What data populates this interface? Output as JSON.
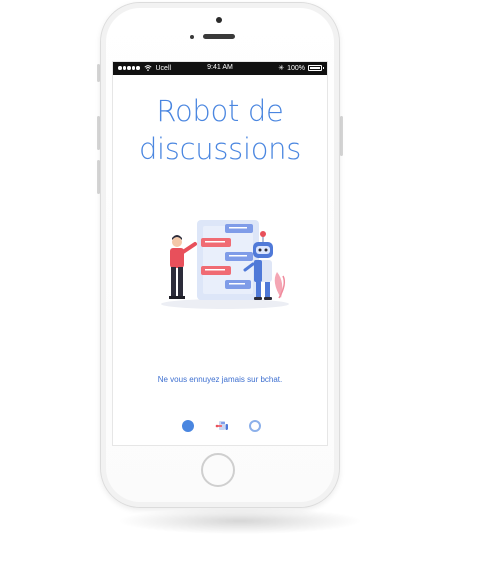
{
  "statusbar": {
    "carrier": "Ucell",
    "time": "9:41 AM",
    "battery_text": "100%",
    "battery_level": 1.0,
    "signal_icon": "signal-dots-icon",
    "wifi_icon": "wifi-icon",
    "bluetooth_icon": "bluetooth-icon"
  },
  "screen": {
    "title_line1": "Robot de",
    "title_line2": "discussions",
    "tagline": "Ne vous ennuyez jamais sur bchat.",
    "illustration": "man-chatting-with-robot-illustration"
  },
  "pager": {
    "pages": 3,
    "current": 1,
    "middle_icon": "mini-illustration-icon"
  },
  "colors": {
    "accent": "#4a86e0",
    "tagline": "#3d6fd0",
    "statusbar_bg": "#111111",
    "bubble_red": "#f06b73",
    "bubble_blue": "#7f9ce8"
  }
}
